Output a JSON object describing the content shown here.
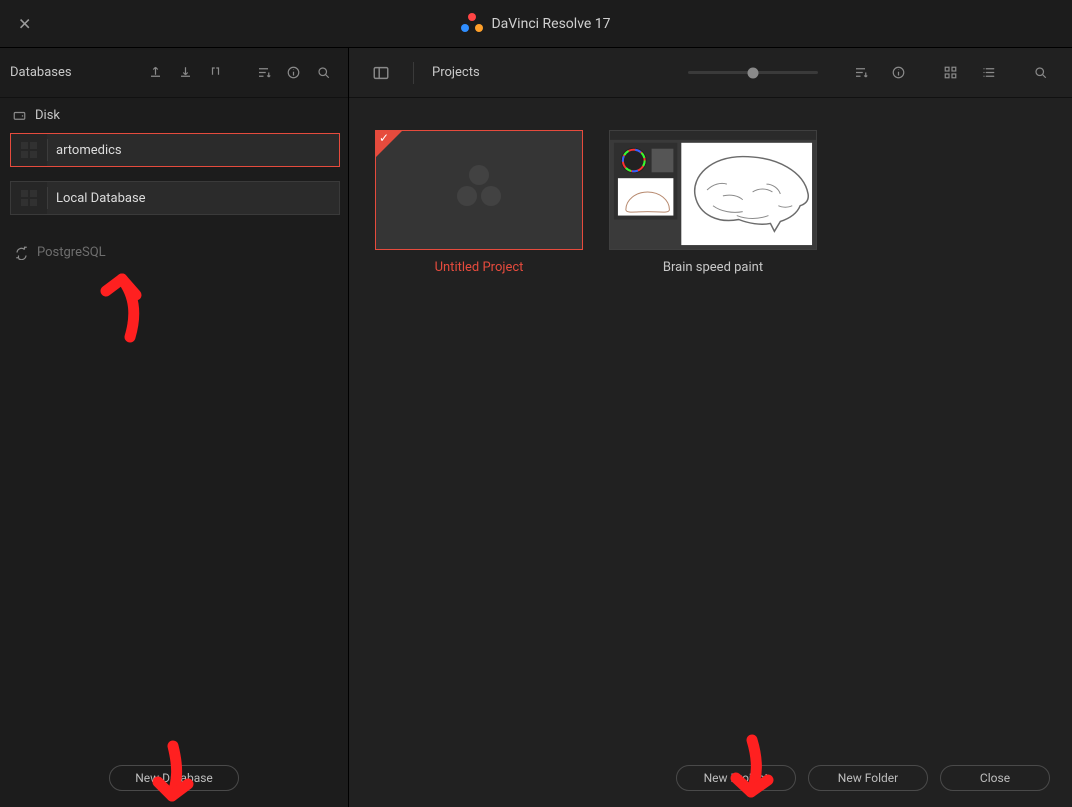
{
  "app": {
    "title": "DaVinci Resolve 17"
  },
  "sidebar": {
    "title": "Databases",
    "disk_label": "Disk",
    "databases": [
      {
        "name": "artomedics",
        "selected": true
      },
      {
        "name": "Local Database",
        "selected": false
      }
    ],
    "postgres_label": "PostgreSQL",
    "new_database_btn": "New Database"
  },
  "content": {
    "title": "Projects",
    "projects": [
      {
        "name": "Untitled Project",
        "selected": true,
        "blank": true
      },
      {
        "name": "Brain speed paint",
        "selected": false,
        "blank": false
      }
    ],
    "slider_pos_pct": 50,
    "footer": {
      "new_project": "New Project",
      "new_folder": "New Folder",
      "close": "Close"
    }
  }
}
